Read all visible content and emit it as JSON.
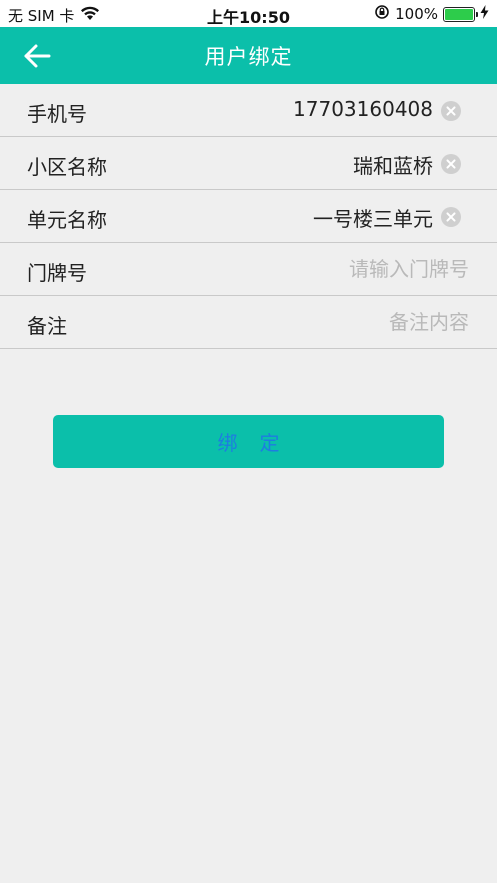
{
  "status_bar": {
    "carrier": "无 SIM 卡",
    "wifi_icon": "wifi-icon",
    "time": "上午10:50",
    "orientation_lock_icon": "orientation-lock-icon",
    "battery_percent_text": "100%",
    "battery_level": 1.0,
    "charging_icon": "bolt-icon"
  },
  "nav": {
    "back_icon": "arrow-left-icon",
    "title": "用户绑定"
  },
  "form": {
    "rows": [
      {
        "label": "手机号",
        "value": "17703160408",
        "clearable": true
      },
      {
        "label": "小区名称",
        "value": "瑞和蓝桥",
        "clearable": true
      },
      {
        "label": "单元名称",
        "value": "一号楼三单元",
        "clearable": true
      },
      {
        "label": "门牌号",
        "value": "",
        "placeholder": "请输入门牌号"
      },
      {
        "label": "备注",
        "value": "",
        "placeholder": "备注内容"
      }
    ]
  },
  "bind_button": {
    "label": "绑定"
  },
  "colors": {
    "primary": "#0bbfaa",
    "button_text": "#1e7de0",
    "background": "#efefef",
    "placeholder": "#b9b9b9"
  }
}
